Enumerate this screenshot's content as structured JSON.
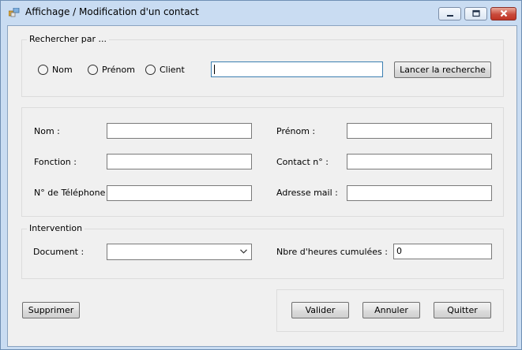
{
  "window": {
    "title": "Affichage / Modification d'un contact",
    "controls": {
      "minimize": "minimize-icon",
      "maximize": "maximize-icon",
      "close": "close-icon"
    }
  },
  "search": {
    "group_title": "Rechercher par ...",
    "options": [
      "Nom",
      "Prénom",
      "Client"
    ],
    "query_value": "",
    "button_label": "Lancer la recherche"
  },
  "contact": {
    "nom_label": "Nom :",
    "nom_value": "",
    "prenom_label": "Prénom :",
    "prenom_value": "",
    "fonction_label": "Fonction :",
    "fonction_value": "",
    "contact_no_label": "Contact n° :",
    "contact_no_value": "",
    "telephone_label": "N° de Téléphone :",
    "telephone_value": "",
    "email_label": "Adresse mail :",
    "email_value": ""
  },
  "intervention": {
    "group_title": "Intervention",
    "document_label": "Document :",
    "document_value": "",
    "heures_label": "Nbre d'heures cumulées :",
    "heures_value": "0"
  },
  "actions": {
    "delete_label": "Supprimer",
    "validate_label": "Valider",
    "cancel_label": "Annuler",
    "quit_label": "Quitter"
  },
  "colors": {
    "titlebar": "#c9dcf2",
    "client_background": "#f0f0f0",
    "close_button": "#c94a3b",
    "focus_border": "#3c7fb1"
  }
}
